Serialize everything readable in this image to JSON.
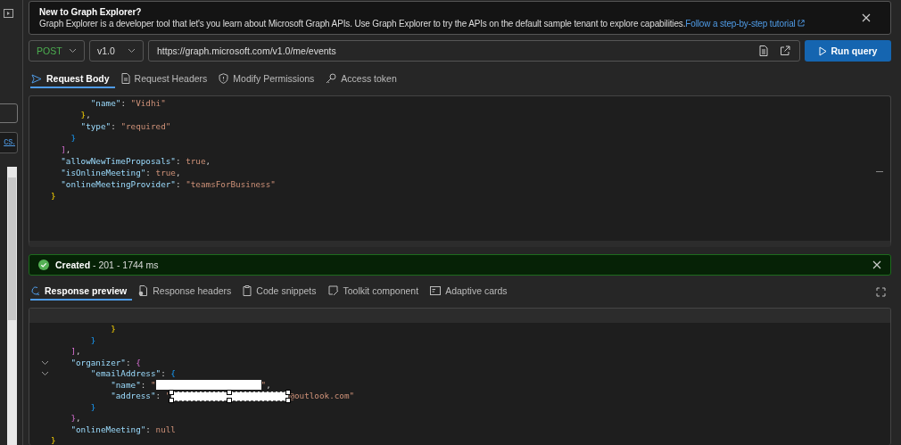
{
  "sidebar": {
    "link": "cs."
  },
  "banner": {
    "title": "New to Graph Explorer?",
    "text": "Graph Explorer is a developer tool that let's you learn about Microsoft Graph APIs. Use Graph Explorer to try the APIs on the default sample tenant to explore capabilities.",
    "link": "Follow a step-by-step tutorial"
  },
  "query": {
    "method": "POST",
    "version": "v1.0",
    "url": "https://graph.microsoft.com/v1.0/me/events",
    "run_button": "Run query"
  },
  "request_tabs": [
    {
      "label": "Request Body",
      "selected": true
    },
    {
      "label": "Request Headers",
      "selected": false
    },
    {
      "label": "Modify Permissions",
      "selected": false
    },
    {
      "label": "Access token",
      "selected": false
    }
  ],
  "request_body": [
    [
      {
        "text": "        \"name\"",
        "kind": "key"
      },
      {
        "text": ": ",
        "kind": "punct"
      },
      {
        "text": "\"Vidhi\"",
        "kind": "str"
      }
    ],
    [
      {
        "text": "      }",
        "kind": "b1"
      },
      {
        "text": ",",
        "kind": "punct"
      }
    ],
    [
      {
        "text": "      \"type\"",
        "kind": "key"
      },
      {
        "text": ": ",
        "kind": "punct"
      },
      {
        "text": "\"required\"",
        "kind": "str"
      }
    ],
    [
      {
        "text": "    }",
        "kind": "b3"
      }
    ],
    [
      {
        "text": "  ]",
        "kind": "b2"
      },
      {
        "text": ",",
        "kind": "punct"
      }
    ],
    [
      {
        "text": "  \"allowNewTimeProposals\"",
        "kind": "key"
      },
      {
        "text": ": ",
        "kind": "punct"
      },
      {
        "text": "true",
        "kind": "str"
      },
      {
        "text": ",",
        "kind": "punct"
      }
    ],
    [
      {
        "text": "  \"isOnlineMeeting\"",
        "kind": "key"
      },
      {
        "text": ": ",
        "kind": "punct"
      },
      {
        "text": "true",
        "kind": "str"
      },
      {
        "text": ",",
        "kind": "punct"
      }
    ],
    [
      {
        "text": "  \"onlineMeetingProvider\"",
        "kind": "key"
      },
      {
        "text": ": ",
        "kind": "punct"
      },
      {
        "text": "\"teamsForBusiness\"",
        "kind": "str"
      }
    ],
    [
      {
        "text": "}",
        "kind": "b1"
      }
    ]
  ],
  "status": {
    "text": "**Created** - 201 - 1744 ms"
  },
  "response_tabs": [
    {
      "label": "Response preview",
      "selected": true
    },
    {
      "label": "Response headers",
      "selected": false
    },
    {
      "label": "Code snippets",
      "selected": false
    },
    {
      "label": "Toolkit component",
      "selected": false
    },
    {
      "label": "Adaptive cards",
      "selected": false
    }
  ],
  "response_body": [
    {
      "tokens": [
        {
          "text": "            }",
          "kind": "b1"
        }
      ]
    },
    {
      "tokens": [
        {
          "text": "        }",
          "kind": "b3"
        }
      ]
    },
    {
      "tokens": [
        {
          "text": "    ]",
          "kind": "b2"
        },
        {
          "text": ",",
          "kind": "punct"
        }
      ]
    },
    {
      "expanded": true,
      "tokens": [
        {
          "text": "    \"organizer\"",
          "kind": "key"
        },
        {
          "text": ": ",
          "kind": "punct"
        },
        {
          "text": "{",
          "kind": "b2"
        }
      ]
    },
    {
      "expanded": true,
      "tokens": [
        {
          "text": "        \"emailAddress\"",
          "kind": "key"
        },
        {
          "text": ": ",
          "kind": "punct"
        },
        {
          "text": "{",
          "kind": "b3"
        }
      ]
    },
    {
      "tokens": [
        {
          "text": "            \"name\"",
          "kind": "key"
        },
        {
          "text": ": ",
          "kind": "punct"
        },
        {
          "text": "\"",
          "kind": "str"
        },
        {
          "kind": "redacted"
        },
        {
          "text": "\"",
          "kind": "str"
        },
        {
          "text": ",",
          "kind": "punct"
        }
      ]
    },
    {
      "tokens": [
        {
          "text": "            \"address\"",
          "kind": "key"
        },
        {
          "text": ": ",
          "kind": "punct"
        },
        {
          "text": "\"",
          "kind": "str"
        },
        {
          "kind": "redacted-selected"
        },
        {
          "text": "@outlook.com\"",
          "kind": "str"
        }
      ]
    },
    {
      "tokens": [
        {
          "text": "        }",
          "kind": "b3"
        }
      ]
    },
    {
      "tokens": [
        {
          "text": "    }",
          "kind": "b2"
        },
        {
          "text": ",",
          "kind": "punct"
        }
      ]
    },
    {
      "tokens": [
        {
          "text": "    \"onlineMeeting\"",
          "kind": "key"
        },
        {
          "text": ": ",
          "kind": "punct"
        },
        {
          "text": "null",
          "kind": "str"
        }
      ]
    },
    {
      "tokens": [
        {
          "text": "}",
          "kind": "b1"
        }
      ]
    }
  ]
}
